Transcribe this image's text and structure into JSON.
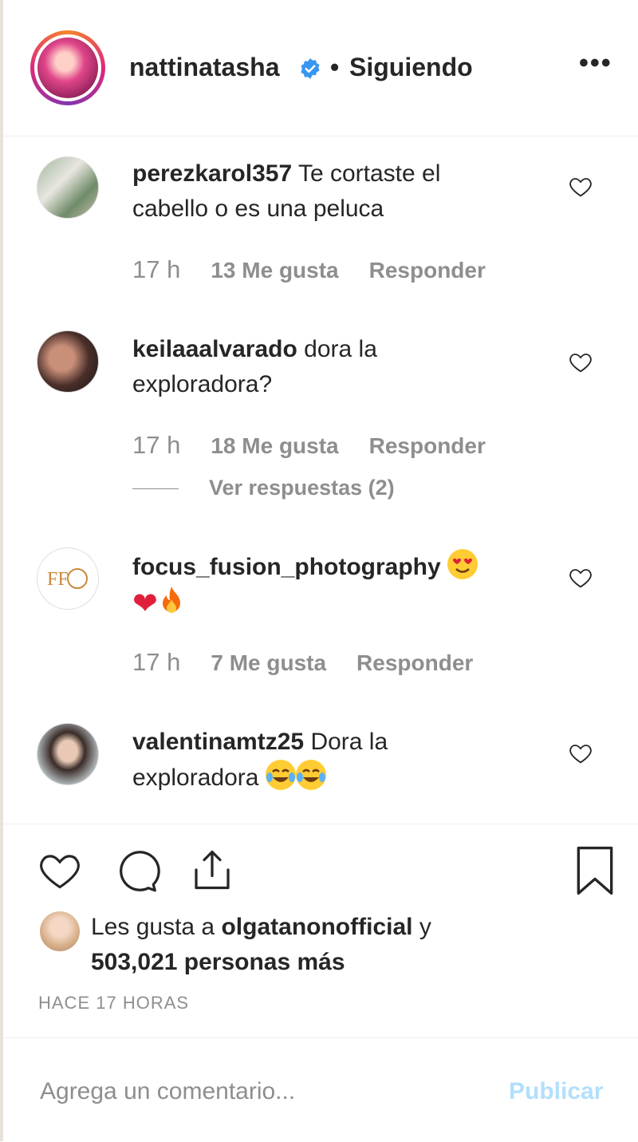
{
  "post_header": {
    "username": "nattinatasha",
    "separator": "•",
    "follow_status": "Siguiendo",
    "more_label": "•••"
  },
  "comments": [
    {
      "username": "perezkarol357",
      "text": "Te cortaste el cabello o es una peluca",
      "time": "17 h",
      "likes": "13 Me gusta",
      "reply": "Responder"
    },
    {
      "username": "keilaaalvarado",
      "text": "dora la exploradora?",
      "time": "17 h",
      "likes": "18 Me gusta",
      "reply": "Responder",
      "view_replies": "Ver respuestas (2)"
    },
    {
      "username": "focus_fusion_photography",
      "text": "",
      "emojis": [
        "heart-eyes-emoji",
        "red-heart-emoji",
        "fire-emoji"
      ],
      "time": "17 h",
      "likes": "7 Me gusta",
      "reply": "Responder"
    },
    {
      "username": "valentinamtz25",
      "text": "Dora la exploradora",
      "emojis": [
        "tears-of-joy-emoji",
        "tears-of-joy-emoji"
      ]
    }
  ],
  "likes_summary": {
    "prefix": "Les gusta a",
    "user": "olgatanonofficial",
    "conjunction": "y",
    "count": "503,021 personas más"
  },
  "timestamp": "HACE 17 HORAS",
  "composer": {
    "placeholder": "Agrega un comentario...",
    "submit_label": "Publicar"
  },
  "colors": {
    "verified": "#3897f0",
    "muted_text": "#8e8e8e",
    "publish_disabled": "#b2dffc"
  }
}
